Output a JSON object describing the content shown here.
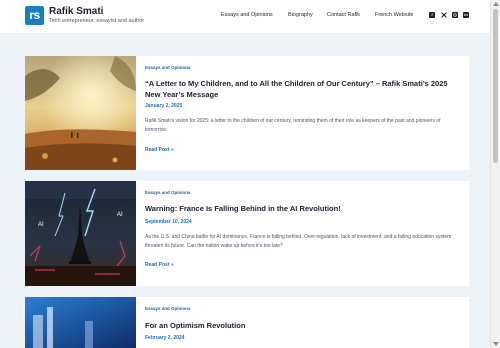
{
  "header": {
    "logo_text": "rs",
    "site_title": "Rafik Smati",
    "tagline": "Tech entrepreneur, essayist and author",
    "nav": [
      "Essays and Opinions",
      "Biography",
      "Contact Rafik",
      "French Website"
    ],
    "social_icons": [
      "facebook-icon",
      "x-icon",
      "instagram-icon",
      "linkedin-icon"
    ]
  },
  "colors": {
    "accent": "#1a7fc1",
    "link": "#1a6fb8",
    "background": "#edf2f7"
  },
  "posts": [
    {
      "category": "Essays and Opinions",
      "title": "“A Letter to My Children, and to All the Children of Our Century” – Rafik Smati’s 2025 New Year’s Message",
      "date": "January 2, 2025",
      "excerpt": "Rafik Smati’s vision for 2025: a letter to the children of our century, reminding them of their role as keepers of the past and pioneers of tomorrow.",
      "read_more": "Read Post »"
    },
    {
      "category": "Essays and Opinions",
      "title": "Warning: France Is Falling Behind in the AI Revolution!",
      "date": "September 10, 2024",
      "excerpt": "As the U.S. and China battle for AI dominance, France is falling behind. Over-regulation, lack of investment, and a failing education system threaten its future. Can the nation wake up before it’s too late?",
      "read_more": "Read Post »",
      "image_labels": [
        "AI",
        "AI"
      ]
    },
    {
      "category": "Essays and Opinions",
      "title": "For an Optimism Revolution",
      "date": "February 2, 2024"
    }
  ]
}
